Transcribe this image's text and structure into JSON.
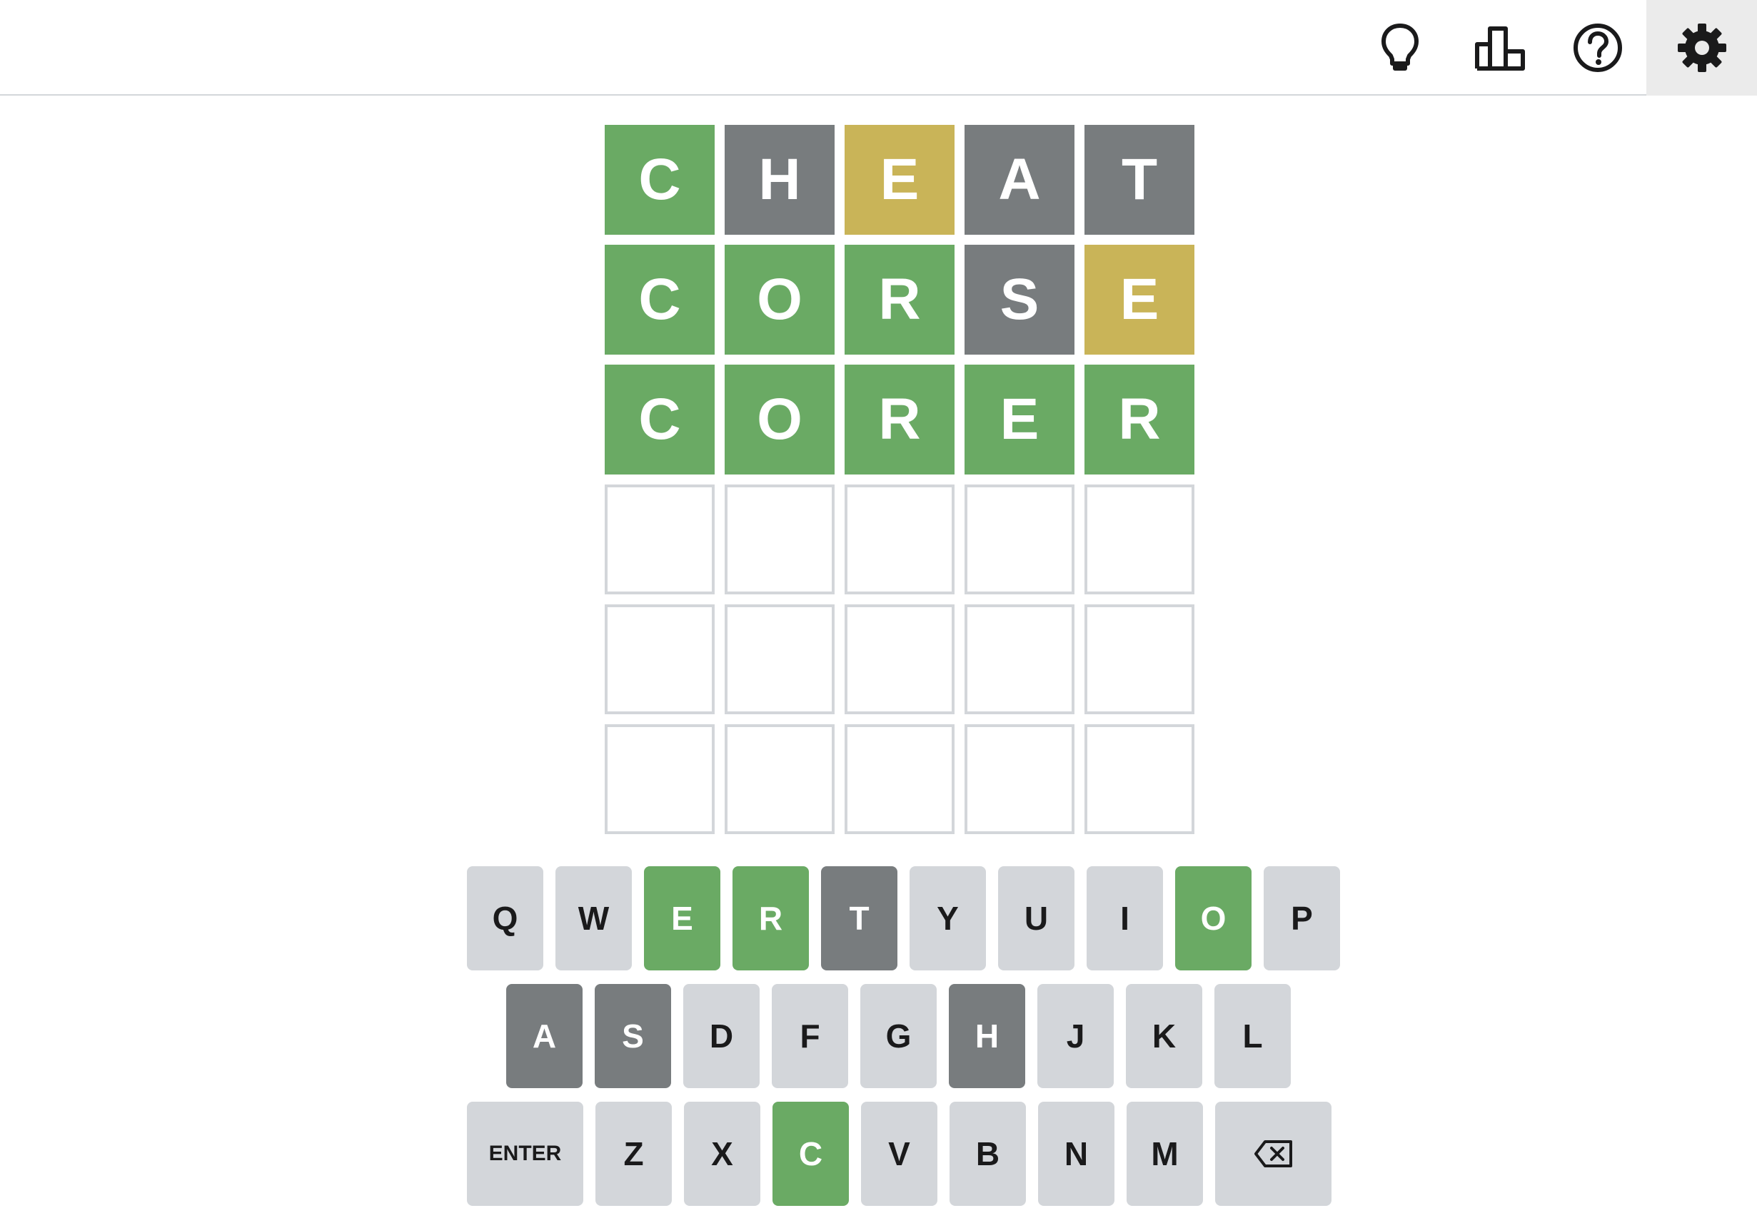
{
  "header": {
    "icons": [
      {
        "name": "hint-icon",
        "icon": "lightbulb"
      },
      {
        "name": "statistics-icon",
        "icon": "bar-chart"
      },
      {
        "name": "help-icon",
        "icon": "question-circle"
      },
      {
        "name": "settings-icon",
        "icon": "gear",
        "active": true
      }
    ]
  },
  "colors": {
    "correct": "#6aaa64",
    "present": "#c9b458",
    "absent": "#787c7e",
    "key_default": "#d3d6da",
    "empty_border": "#d3d6da"
  },
  "board": {
    "rows": [
      {
        "letters": [
          "C",
          "H",
          "E",
          "A",
          "T"
        ],
        "states": [
          "correct",
          "absent",
          "present",
          "absent",
          "absent"
        ]
      },
      {
        "letters": [
          "C",
          "O",
          "R",
          "S",
          "E"
        ],
        "states": [
          "correct",
          "correct",
          "correct",
          "absent",
          "present"
        ]
      },
      {
        "letters": [
          "C",
          "O",
          "R",
          "E",
          "R"
        ],
        "states": [
          "correct",
          "correct",
          "correct",
          "correct",
          "correct"
        ]
      },
      {
        "letters": [
          "",
          "",
          "",
          "",
          ""
        ],
        "states": [
          "empty",
          "empty",
          "empty",
          "empty",
          "empty"
        ]
      },
      {
        "letters": [
          "",
          "",
          "",
          "",
          ""
        ],
        "states": [
          "empty",
          "empty",
          "empty",
          "empty",
          "empty"
        ]
      },
      {
        "letters": [
          "",
          "",
          "",
          "",
          ""
        ],
        "states": [
          "empty",
          "empty",
          "empty",
          "empty",
          "empty"
        ]
      }
    ]
  },
  "keyboard": {
    "rows": [
      [
        {
          "label": "Q",
          "state": "default"
        },
        {
          "label": "W",
          "state": "default"
        },
        {
          "label": "E",
          "state": "correct"
        },
        {
          "label": "R",
          "state": "correct"
        },
        {
          "label": "T",
          "state": "absent"
        },
        {
          "label": "Y",
          "state": "default"
        },
        {
          "label": "U",
          "state": "default"
        },
        {
          "label": "I",
          "state": "default"
        },
        {
          "label": "O",
          "state": "correct"
        },
        {
          "label": "P",
          "state": "default"
        }
      ],
      [
        {
          "label": "A",
          "state": "absent"
        },
        {
          "label": "S",
          "state": "absent"
        },
        {
          "label": "D",
          "state": "default"
        },
        {
          "label": "F",
          "state": "default"
        },
        {
          "label": "G",
          "state": "default"
        },
        {
          "label": "H",
          "state": "absent"
        },
        {
          "label": "J",
          "state": "default"
        },
        {
          "label": "K",
          "state": "default"
        },
        {
          "label": "L",
          "state": "default"
        }
      ],
      [
        {
          "label": "ENTER",
          "state": "default",
          "wide": true
        },
        {
          "label": "Z",
          "state": "default"
        },
        {
          "label": "X",
          "state": "default"
        },
        {
          "label": "C",
          "state": "correct"
        },
        {
          "label": "V",
          "state": "default"
        },
        {
          "label": "B",
          "state": "default"
        },
        {
          "label": "N",
          "state": "default"
        },
        {
          "label": "M",
          "state": "default"
        },
        {
          "label": "",
          "state": "default",
          "wide": true,
          "icon": "backspace-icon"
        }
      ]
    ]
  }
}
